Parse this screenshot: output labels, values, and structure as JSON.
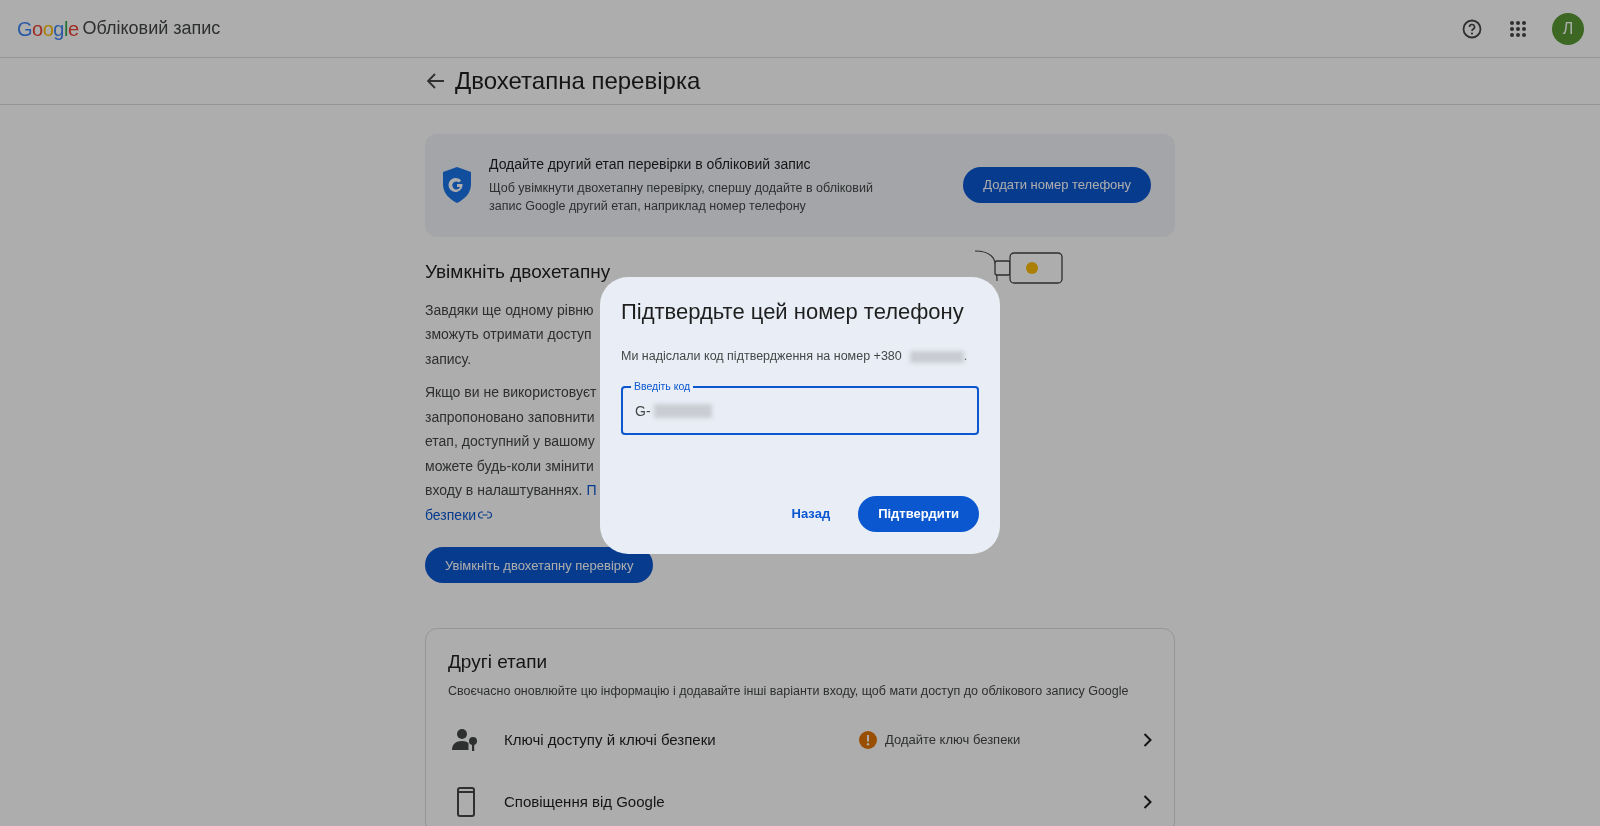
{
  "header": {
    "logo": "Google",
    "product": "Обліковий запис",
    "avatar": "Л"
  },
  "page": {
    "title": "Двохетапна перевірка"
  },
  "banner": {
    "title": "Додайте другий етап перевірки в обліковий запис",
    "text": "Щоб увімкнути двохетапну перевірку, спершу додайте в обліковий запис Google другий етап, наприклад номер телефону",
    "button": "Додати номер телефону"
  },
  "intro": {
    "heading": "Увімкніть двохетапну",
    "paragraphs": [
      [
        {
          "text": "Завдяки ще одному рівню"
        },
        {
          "text": "зможуть отримати доступ"
        },
        {
          "text": "запису."
        }
      ],
      [
        {
          "text": "Якщо ви не використовуєт"
        },
        {
          "text": "запропоновано заповнити"
        },
        {
          "text": "етап, доступний у вашому"
        },
        {
          "text": "можете будь-коли змінити"
        },
        {
          "text": "входу в налаштуваннях.",
          "link": "П"
        },
        {
          "link": "безпеки"
        }
      ]
    ],
    "button": "Увімкніть двохетапну перевірку"
  },
  "other_steps": {
    "title": "Другі етапи",
    "subtitle": "Своєчасно оновлюйте цю інформацію і додавайте інші варіанти входу, щоб мати доступ до облікового запису Google",
    "items": [
      {
        "kind": "passkey",
        "label": "Ключі доступу й ключі безпеки",
        "status": "Додайте ключ безпеки"
      },
      {
        "kind": "phone",
        "label": "Сповіщення від Google"
      }
    ]
  },
  "dialog": {
    "title": "Підтвердьте цей номер телефону",
    "message": "Ми надіслали код підтвердження на номер +380",
    "message_end": ".",
    "field": {
      "label": "Введіть код",
      "value": "G-"
    },
    "buttons": [
      {
        "kind": "text",
        "label": "Назад"
      },
      {
        "kind": "filled",
        "label": "Підтвердити"
      }
    ]
  }
}
